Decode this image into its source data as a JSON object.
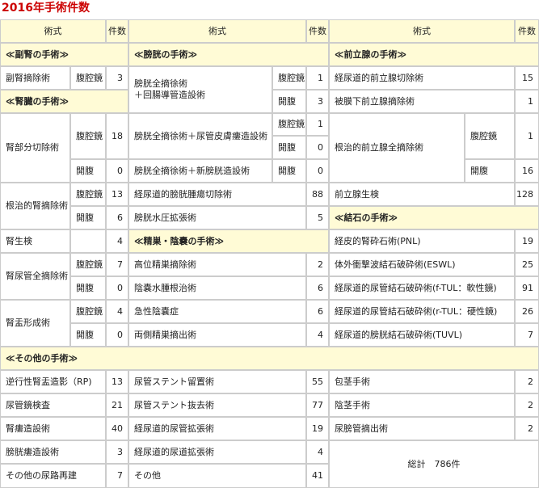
{
  "title": "2016年手術件数",
  "headers": {
    "name": "術式",
    "count": "件数"
  },
  "sections": {
    "adrenal": "≪副腎の手術≫",
    "kidney": "≪腎臓の手術≫",
    "bladder": "≪膀胱の手術≫",
    "prostate": "≪前立腺の手術≫",
    "stone": "≪結石の手術≫",
    "testis": "≪精巣・陰嚢の手術≫",
    "other": "≪その他の手術≫"
  },
  "approach": {
    "laparoscopic": "腹腔鏡",
    "open": "開腹"
  },
  "adrenal": {
    "name": "副腎摘除術",
    "laparoscopic": "3"
  },
  "kidney": {
    "partial": {
      "name": "腎部分切除術",
      "laparoscopic": "18",
      "open": "0"
    },
    "radical": {
      "name": "根治的腎摘除術",
      "laparoscopic": "13",
      "open": "6"
    },
    "biopsy": {
      "name": "腎生検",
      "count": "4"
    },
    "nephroureterectomy": {
      "name": "腎尿管全摘除術",
      "laparoscopic": "7",
      "open": "0"
    },
    "pyeloplasty": {
      "name": "腎盂形成術",
      "laparoscopic": "4",
      "open": "0"
    }
  },
  "bladder": {
    "cystectomy_ileal": {
      "name_line1": "膀胱全摘徐術",
      "name_line2": "＋回腸導管造設術",
      "laparoscopic": "1",
      "open": "3"
    },
    "cystectomy_ureterostomy": {
      "name": "膀胱全摘徐術＋尿管皮膚瘻造設術",
      "laparoscopic": "1",
      "open": "0"
    },
    "cystectomy_neobladder": {
      "name": "膀胱全摘徐術＋新膀胱造設術",
      "open": "0"
    },
    "turbt": {
      "name": "経尿道的膀胱腫瘍切除術",
      "count": "88"
    },
    "hydrodistension": {
      "name": "膀胱水圧拡張術",
      "count": "5"
    }
  },
  "testis": [
    {
      "name": "高位精巣摘除術",
      "count": "2"
    },
    {
      "name": "陰嚢水腫根治術",
      "count": "6"
    },
    {
      "name": "急性陰嚢症",
      "count": "6"
    },
    {
      "name": "両側精巣摘出術",
      "count": "4"
    }
  ],
  "prostate": {
    "turp": {
      "name": "経尿道的前立腺切除術",
      "count": "15"
    },
    "retro": {
      "name": "被膜下前立腺摘除術",
      "count": "1"
    },
    "radical": {
      "name": "根治的前立腺全摘除術",
      "laparoscopic": "1",
      "open": "16"
    },
    "biopsy": {
      "name": "前立腺生検",
      "count": "128"
    }
  },
  "stone": [
    {
      "name": "経皮的腎砕石術(PNL)",
      "count": "19"
    },
    {
      "name": "体外衝撃波結石破砕術(ESWL)",
      "count": "25"
    },
    {
      "name": "経尿道的尿管結石破砕術(f-TUL：軟性鏡)",
      "count": "91"
    },
    {
      "name": "経尿道的尿管結石破砕術(r-TUL：硬性鏡)",
      "count": "26"
    },
    {
      "name": "経尿道的膀胱結石破砕術(TUVL)",
      "count": "7"
    }
  ],
  "other_col1": [
    {
      "name": "逆行性腎盂造影（RP)",
      "count": "13"
    },
    {
      "name": "尿管鏡検査",
      "count": "21"
    },
    {
      "name": "腎瘻造設術",
      "count": "40"
    },
    {
      "name": "膀胱瘻造設術",
      "count": "3"
    },
    {
      "name": "その他の尿路再建",
      "count": "7"
    }
  ],
  "other_col2": [
    {
      "name": "尿管ステント留置術",
      "count": "55"
    },
    {
      "name": "尿管ステント抜去術",
      "count": "77"
    },
    {
      "name": "経尿道的尿管拡張術",
      "count": "19"
    },
    {
      "name": "経尿道的尿道拡張術",
      "count": "4"
    },
    {
      "name": "その他",
      "count": "41"
    }
  ],
  "other_col3": [
    {
      "name": "包茎手術",
      "count": "2"
    },
    {
      "name": "陰茎手術",
      "count": "2"
    },
    {
      "name": "尿膀管摘出術",
      "count": "2"
    }
  ],
  "total": "総計　786件"
}
